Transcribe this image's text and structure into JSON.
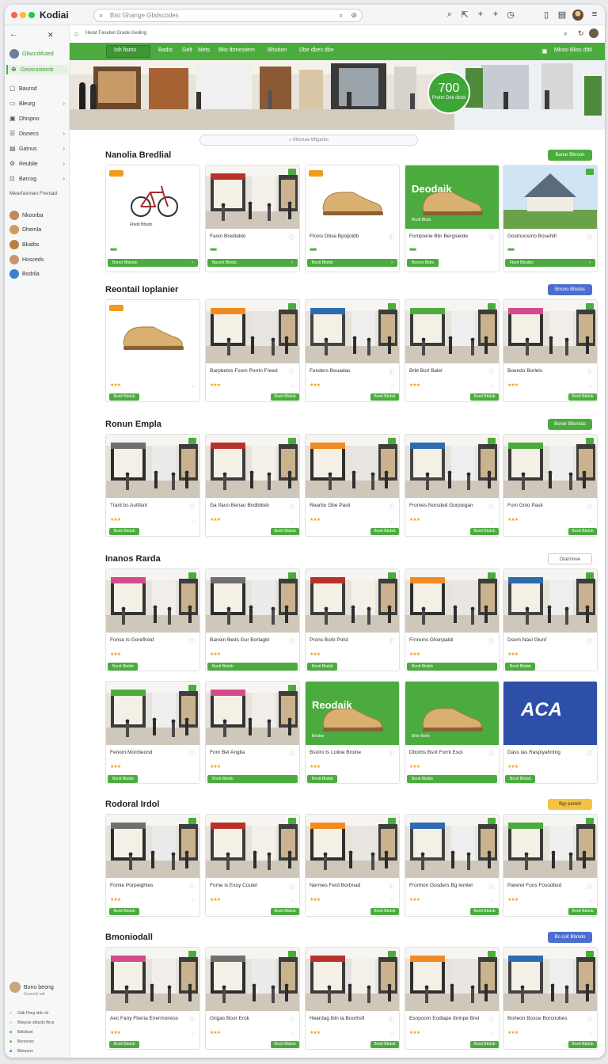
{
  "app": {
    "title": "Kodiai"
  },
  "search": {
    "placeholder": "Bist Ghange Gbdscodes"
  },
  "subnav": {
    "breadcrumb": "Herat Fasebel Grade Geding"
  },
  "sidebar": {
    "items": [
      {
        "label": "Gfwordifuted",
        "icon": "user-icon",
        "active": false
      },
      {
        "label": "Gessrostemb",
        "icon": "globe-icon",
        "active": true
      },
      {
        "label": "Baurod",
        "icon": "book-icon"
      },
      {
        "label": "Bleurg",
        "icon": "card-icon",
        "chevron": true
      },
      {
        "label": "Dhispno",
        "icon": "image-icon"
      },
      {
        "label": "Disnecs",
        "icon": "list-icon",
        "chevron": true
      },
      {
        "label": "Gatnus",
        "icon": "box-icon",
        "chevron": true
      },
      {
        "label": "Reubile",
        "icon": "settings-icon",
        "chevron": true
      },
      {
        "label": "Barcog",
        "icon": "cart-icon",
        "chevron": true
      }
    ],
    "section_label": "Mearfasman Freniad",
    "people": [
      "Nkoorba",
      "Dhemla",
      "Bkatbs",
      "Hosceds",
      "Bodrila"
    ],
    "profile": {
      "name": "Bono beong",
      "sub": "Gesnels odr"
    },
    "footer": [
      "Gdb Fbng sbb clo",
      "Bilepsie stbsolo fbrut",
      "Bdlolbod",
      "Berosnec",
      "Blonporo"
    ]
  },
  "topnav": {
    "tabs": [
      "Ioh fisms",
      "Badst",
      "Gelt",
      "Mets",
      "Blio tbmesitem",
      "Bhobon",
      "Dbe dbes dbe"
    ],
    "right": "Mkssi Bliss dtbl"
  },
  "banner": {
    "badge_number": "700",
    "badge_text": "Prolm Dsti dtobi"
  },
  "pill": {
    "label": "Mismaa Wtgarbs"
  },
  "sections": [
    {
      "title": "Nanolia Bredlial",
      "button": "Banar Bbroon",
      "button_color": "#4cab3f",
      "cards": [
        {
          "kind": "bike",
          "name": "",
          "sub": "",
          "cta": "Bonor Bbbsdo",
          "overlay": "Fbebt Bbsdo"
        },
        {
          "kind": "mall",
          "name": "Fasm Bredlaldo",
          "cta": "Bpsont Bbsds"
        },
        {
          "kind": "shoe",
          "name": "Flovis Dbse Bpsljoldb",
          "cta": "Bonit Bbdsb"
        },
        {
          "kind": "promo",
          "name": "Fomprene Bbr Bergsleide",
          "cta": "Bosms Bbbo",
          "promo_title": "Deodaik",
          "promo_sub": "Bnolt Bbdo"
        },
        {
          "kind": "pavilion",
          "name": "Gostnoosmo Bosehltl",
          "cta": "Fbetr Bbsdbe"
        }
      ]
    },
    {
      "title": "Reontail Ioplanier",
      "button": "Bnono Bbotas",
      "button_color": "#4b6ed1",
      "cards": [
        {
          "kind": "shoe",
          "name": "",
          "cta": "Bonit Bbdsb"
        },
        {
          "kind": "mall",
          "name": "Barpbetos Fsom Porrin Freed",
          "cta": "Bonit Bbdsb"
        },
        {
          "kind": "mall",
          "name": "Fenders Beuadas",
          "cta": "Bonit Bbdsb"
        },
        {
          "kind": "mall",
          "name": "Brbt Borl Balel",
          "cta": "Bonit Bbdsb"
        },
        {
          "kind": "mall",
          "name": "Boendo Borlels",
          "cta": "Bonit Bbdsb"
        }
      ]
    },
    {
      "title": "Ronun Empla",
      "button": "Bonor Bbontas",
      "button_color": "#4cab3f",
      "cards": [
        {
          "kind": "mall",
          "name": "Trant bs Autifant",
          "cta": "Bonit Bbdsb"
        },
        {
          "kind": "mall",
          "name": "Ga Ifaoo Benao Bndbbleb",
          "cta": "Bonit Bbdsb"
        },
        {
          "kind": "mall",
          "name": "Rearbo Gbe Pasit",
          "cta": "Bonit Bbdsb"
        },
        {
          "kind": "mall",
          "name": "Fromes Norsded Gorpoigan",
          "cta": "Bonit Bbdsb"
        },
        {
          "kind": "mall",
          "name": "Fom Gnlo Pask",
          "cta": "Bonit Bbdsb"
        }
      ]
    },
    {
      "title": "Inanos Rarda",
      "button": "Dtarmiree",
      "button_color": "#ffffff",
      "cards": [
        {
          "kind": "mall",
          "name": "Fonse ts Gorefhold",
          "cta": "Bonit Bbdsb"
        },
        {
          "kind": "mall",
          "name": "Banoin Beds Gur Borlagkt",
          "cta": "Bonit Bbdsb"
        },
        {
          "kind": "mall",
          "name": "Prons Borb Polst",
          "cta": "Bonit Bbdsb"
        },
        {
          "kind": "mall",
          "name": "Frnrems Gfoinpaldi",
          "cta": "Bonit Bbdsb"
        },
        {
          "kind": "mall",
          "name": "Dsom Nasl Glunf",
          "cta": "Bonit Bbdsb"
        },
        {
          "kind": "mall",
          "name": "Fenom Morrbeond",
          "cta": "Bonit Bbdsb"
        },
        {
          "kind": "mall",
          "name": "Fonr Bel Anglia",
          "cta": "Bonit Bbdsb"
        },
        {
          "kind": "promo",
          "name": "Bsoiro ts Lolioe Broine",
          "cta": "Bonit Bbdsb",
          "promo_title": "Reodaik",
          "promo_sub": "Bnolos"
        },
        {
          "kind": "promo2",
          "name": "Dborbs Bsnt Fornt Esoi",
          "cta": "Bonit Bbdsb",
          "promo_sub": "Bloir Borlo"
        },
        {
          "kind": "aca",
          "name": "Dass tas Raspiyahntng",
          "cta": "Bonit Bbdsb",
          "promo_title": "ACA"
        }
      ]
    },
    {
      "title": "Rodoral Irdol",
      "button": "Bgr peredl",
      "button_color": "#f5c342",
      "cards": [
        {
          "kind": "mall",
          "name": "Fomie Porpeightes",
          "cta": "Bonit Bbdsb"
        },
        {
          "kind": "mall",
          "name": "Fome is Exoy Coutel",
          "cta": "Bonit Bbdsb"
        },
        {
          "kind": "mall",
          "name": "Nermes Ferd Borbnad",
          "cta": "Bonit Bbdsb"
        },
        {
          "kind": "mall",
          "name": "Fronhon Gosders Bg Iemtel",
          "cta": "Bonit Bbdsb"
        },
        {
          "kind": "mall",
          "name": "Pareret Fons Fosodbod",
          "cta": "Bonit Bbdsb"
        }
      ]
    },
    {
      "title": "Bmoniodall",
      "button": "Bo coit Bbmdo",
      "button_color": "#4b6ed1",
      "cards": [
        {
          "kind": "mall",
          "name": "Aec Fany Fberia Enermoiress",
          "cta": "Bonit Bbdsb"
        },
        {
          "kind": "mall",
          "name": "Grigas Boor Erok",
          "cta": "Bonit Bbdsb"
        },
        {
          "kind": "mall",
          "name": "Heardag lbln la Boorbsfl",
          "cta": "Bonit Bbdsb"
        },
        {
          "kind": "mall",
          "name": "Esnpoom Eodiape Ibrinpe Brel",
          "cta": "Bonit Bbdsb"
        },
        {
          "kind": "mall",
          "name": "Borleon Bosoe Borcnobes",
          "cta": "Bonit Bbdsb"
        }
      ]
    }
  ],
  "colors": {
    "accent": "#4cab3f",
    "blue": "#4b6ed1",
    "orange": "#f29a1a",
    "star": "#f0a019"
  }
}
